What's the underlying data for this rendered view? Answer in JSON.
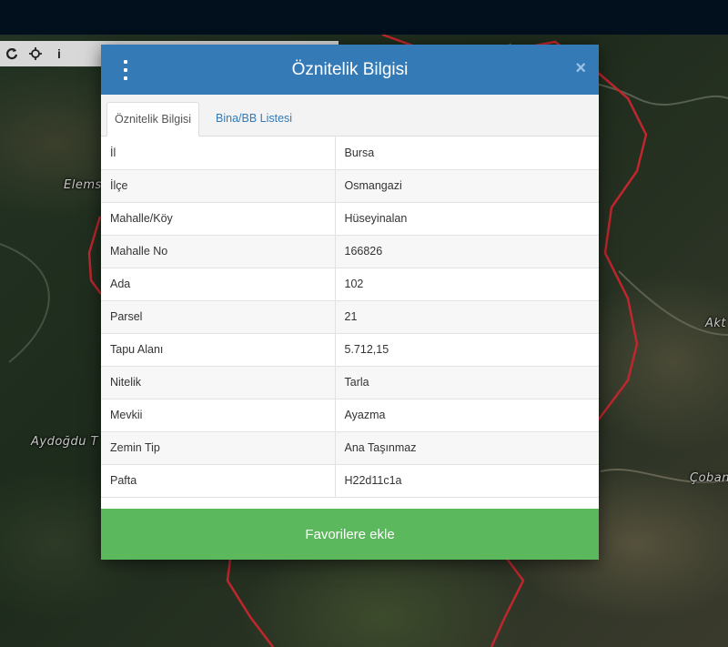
{
  "map": {
    "labels": {
      "elem": "Elems",
      "aydogdu": "Aydoğdu T",
      "akt": "Akt",
      "coban": "Çoban"
    }
  },
  "toolbar": {
    "refresh_icon": "refresh-icon",
    "crosshair_icon": "crosshair-icon",
    "info_label": "i"
  },
  "modal": {
    "title": "Öznitelik Bilgisi",
    "close_label": "×",
    "tabs": [
      {
        "label": "Öznitelik Bilgisi"
      },
      {
        "label": "Bina/BB Listesi"
      }
    ],
    "rows": [
      {
        "key": "İl",
        "value": "Bursa"
      },
      {
        "key": "İlçe",
        "value": "Osmangazi"
      },
      {
        "key": "Mahalle/Köy",
        "value": "Hüseyinalan"
      },
      {
        "key": "Mahalle No",
        "value": "166826"
      },
      {
        "key": "Ada",
        "value": "102"
      },
      {
        "key": "Parsel",
        "value": "21"
      },
      {
        "key": "Tapu Alanı",
        "value": "5.712,15"
      },
      {
        "key": "Nitelik",
        "value": "Tarla"
      },
      {
        "key": "Mevkii",
        "value": "Ayazma"
      },
      {
        "key": "Zemin Tip",
        "value": "Ana Taşınmaz"
      },
      {
        "key": "Pafta",
        "value": "H22d11c1a"
      }
    ],
    "favorite_button": "Favorilere ekle"
  },
  "colors": {
    "header": "#337ab7",
    "button": "#5cb85c",
    "parcel_border": "#c0272d",
    "topbar": "#02101d"
  }
}
